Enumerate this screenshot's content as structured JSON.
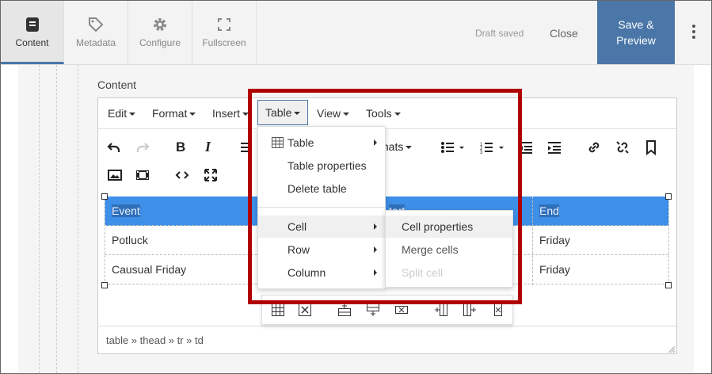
{
  "topbar": {
    "tabs": [
      {
        "label": "Content",
        "icon": "document-icon",
        "active": true
      },
      {
        "label": "Metadata",
        "icon": "tag-icon",
        "active": false
      },
      {
        "label": "Configure",
        "icon": "gear-icon",
        "active": false
      },
      {
        "label": "Fullscreen",
        "icon": "fullscreen-icon",
        "active": false
      }
    ],
    "draft_status": "Draft saved",
    "close_label": "Close",
    "save_label_line1": "Save &",
    "save_label_line2": "Preview"
  },
  "field_label": "Content",
  "menubar": {
    "items": [
      "Edit",
      "Format",
      "Insert",
      "Table",
      "View",
      "Tools"
    ]
  },
  "toolbar": {
    "formats_label": "mats"
  },
  "table": {
    "header": [
      "Event",
      "",
      "End"
    ],
    "header_partial": "tart",
    "rows": [
      [
        "Potluck",
        "Friday"
      ],
      [
        "Causual Friday",
        "Friday"
      ]
    ]
  },
  "table_menu": {
    "items": [
      {
        "label": "Table",
        "has_submenu": true
      },
      {
        "label": "Table properties",
        "has_submenu": false
      },
      {
        "label": "Delete table",
        "has_submenu": false
      },
      {
        "label": "Cell",
        "has_submenu": true
      },
      {
        "label": "Row",
        "has_submenu": true
      },
      {
        "label": "Column",
        "has_submenu": true
      }
    ]
  },
  "cell_submenu": {
    "items": [
      {
        "label": "Cell properties",
        "disabled": false
      },
      {
        "label": "Merge cells",
        "disabled": false
      },
      {
        "label": "Split cell",
        "disabled": true
      }
    ]
  },
  "statusbar": {
    "path": "table » thead » tr » td"
  },
  "colors": {
    "accent": "#4a76a8",
    "selection": "#3d8fe8",
    "highlight_box": "#b00000"
  }
}
